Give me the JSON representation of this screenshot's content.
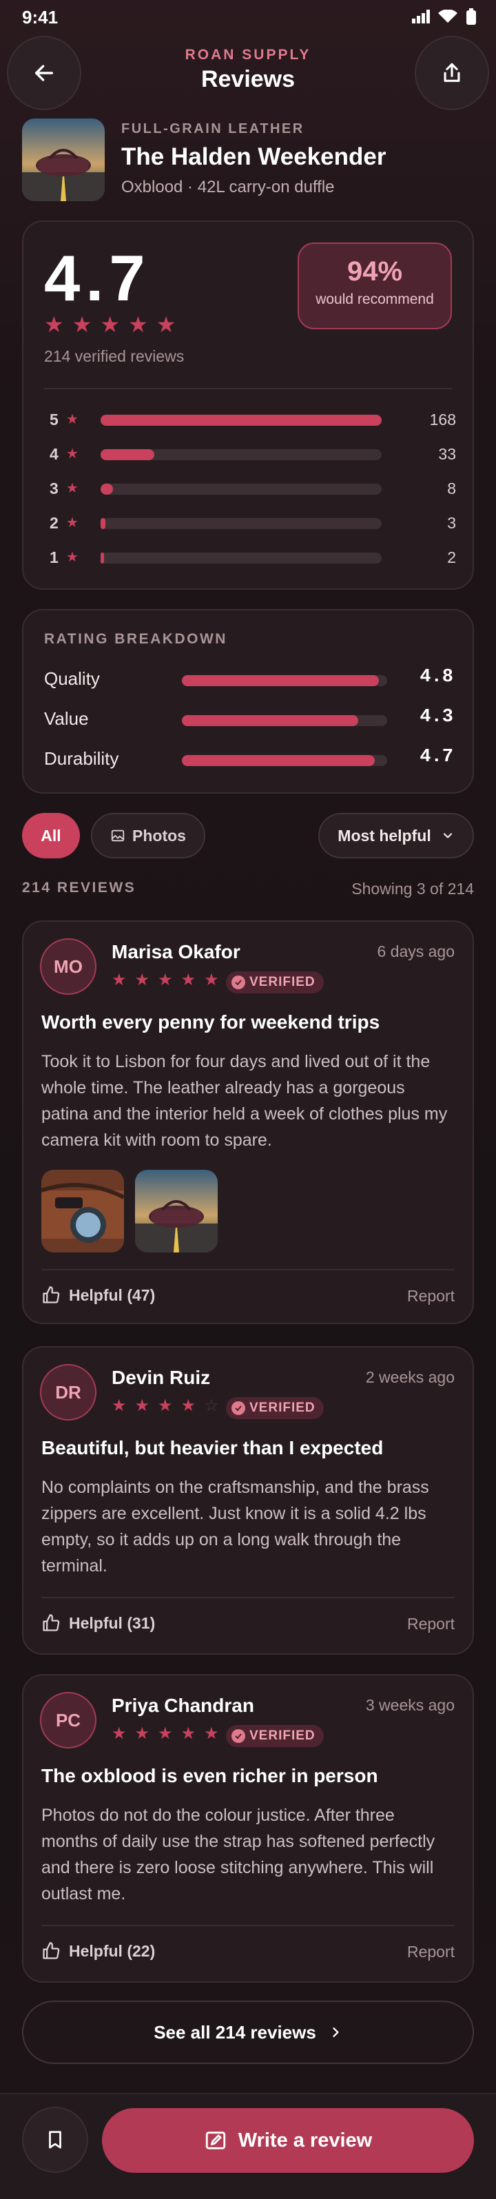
{
  "status": {
    "time": "9:41"
  },
  "header": {
    "brand": "ROAN SUPPLY",
    "title": "Reviews",
    "back_icon": "arrow-left-icon",
    "share_icon": "share-icon"
  },
  "product": {
    "category": "FULL-GRAIN LEATHER",
    "name": "The Halden Weekender",
    "subtitle": "Oxblood · 42L carry-on duffle"
  },
  "summary": {
    "rating": "4.7",
    "stars": 5,
    "recommend_pct": "94%",
    "recommend_label": "would recommend",
    "verified_reviews": "214 verified reviews",
    "histogram": [
      {
        "label": "5",
        "count": "168",
        "fraction": 1.0
      },
      {
        "label": "4",
        "count": "33",
        "fraction": 0.19
      },
      {
        "label": "3",
        "count": "8",
        "fraction": 0.045
      },
      {
        "label": "2",
        "count": "3",
        "fraction": 0.018
      },
      {
        "label": "1",
        "count": "2",
        "fraction": 0.012
      }
    ]
  },
  "breakdown": {
    "title": "RATING BREAKDOWN",
    "rows": [
      {
        "name": "Quality",
        "value": "4.8",
        "fraction": 0.96
      },
      {
        "name": "Value",
        "value": "4.3",
        "fraction": 0.86
      },
      {
        "name": "Durability",
        "value": "4.7",
        "fraction": 0.94
      }
    ]
  },
  "filters": {
    "all": "All",
    "photos": "Photos",
    "sort": "Most helpful"
  },
  "list": {
    "count_label": "214 REVIEWS",
    "showing": "Showing 3 of 214"
  },
  "reviews": [
    {
      "initials": "MO",
      "name": "Marisa Okafor",
      "date": "6 days ago",
      "stars": 5,
      "badge": "VERIFIED",
      "title": "Worth every penny for weekend trips",
      "body": "Took it to Lisbon for four days and lived out of it the whole time. The leather already has a gorgeous patina and the interior held a week of clothes plus my camera kit with room to spare.",
      "helpful": "Helpful (47)",
      "report": "Report"
    },
    {
      "initials": "DR",
      "name": "Devin Ruiz",
      "date": "2 weeks ago",
      "stars": 4,
      "badge": "VERIFIED",
      "title": "Beautiful, but heavier than I expected",
      "body": "No complaints on the craftsmanship, and the brass zippers are excellent. Just know it is a solid 4.2 lbs empty, so it adds up on a long walk through the terminal.",
      "helpful": "Helpful (31)",
      "report": "Report"
    },
    {
      "initials": "PC",
      "name": "Priya Chandran",
      "date": "3 weeks ago",
      "stars": 5,
      "badge": "VERIFIED",
      "title": "The oxblood is even richer in person",
      "body": "Photos do not do the colour justice. After three months of daily use the strap has softened perfectly and there is zero loose stitching anywhere. This will outlast me.",
      "helpful": "Helpful (22)",
      "report": "Report"
    }
  ],
  "see_all": "See all 214 reviews",
  "bottom": {
    "write": "Write a review",
    "bookmark_icon": "bookmark-icon",
    "write_icon": "edit-icon"
  },
  "colors": {
    "accent": "#c9415c",
    "background": "#1c1416",
    "card": "#261c20"
  }
}
